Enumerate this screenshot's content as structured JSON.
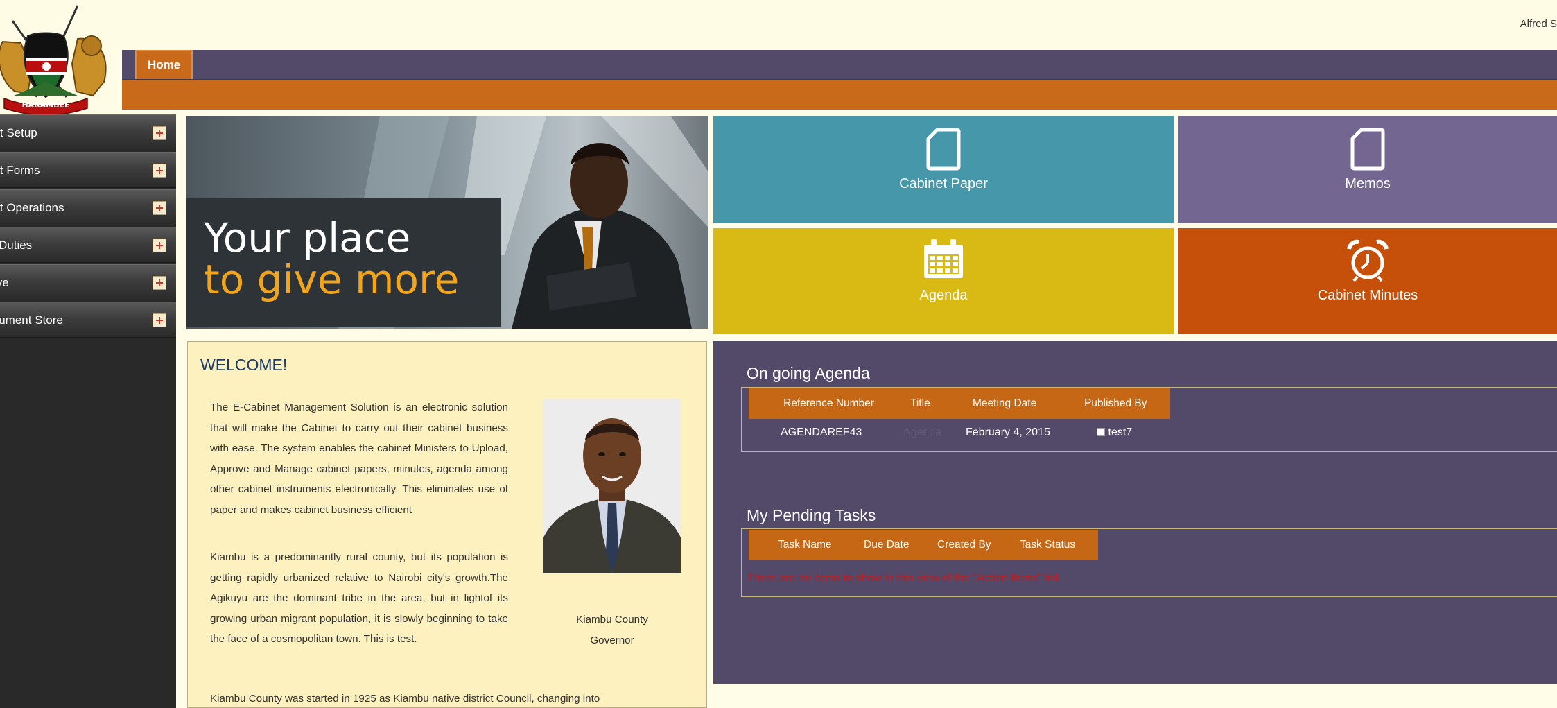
{
  "header": {
    "user_name": "Alfred S",
    "nav_tabs": [
      {
        "label": "Home"
      }
    ]
  },
  "sidebar": {
    "items": [
      {
        "label": "Cabinet Setup"
      },
      {
        "label": "Cabinet Forms"
      },
      {
        "label": "Cabinet Operations"
      },
      {
        "label": "Duties"
      },
      {
        "label": "Archive"
      },
      {
        "label": "Document Store"
      }
    ]
  },
  "banner": {
    "line1": "Your place",
    "line2": "to give more"
  },
  "tiles": {
    "cabinet_paper": {
      "label": "Cabinet Paper",
      "icon": "document-icon",
      "color": "#4597a9"
    },
    "memos": {
      "label": "Memos",
      "icon": "document-icon",
      "color": "#736792"
    },
    "agenda": {
      "label": "Agenda",
      "icon": "calendar-icon",
      "color": "#d9ba14"
    },
    "cabinet_minutes": {
      "label": "Cabinet Minutes",
      "icon": "alarm-clock-icon",
      "color": "#c6500a"
    }
  },
  "welcome": {
    "title": "WELCOME!",
    "para1": "The E-Cabinet Management Solution is an electronic solution that will make the Cabinet to carry out their cabinet business with ease. The system enables the cabinet Ministers to Upload, Approve and Manage cabinet papers, minutes, agenda among other  cabinet instruments electronically. This eliminates use of paper and makes cabinet business efficient",
    "para2": "Kiambu is a predominantly rural county, but its population is getting rapidly urbanized relative to Nairobi city's growth.The Agikuyu are the dominant tribe in the area, but in lightof its growing urban migrant population, it is slowly beginning to take the face of a cosmopolitan town. This is test.",
    "para3": "Kiambu County was started in 1925 as Kiambu native district Council, changing into",
    "photo_caption_line1": "Kiambu County",
    "photo_caption_line2": "Governor"
  },
  "ongoing_agenda": {
    "title": "On going Agenda",
    "columns": [
      "Reference Number",
      "Title",
      "Meeting Date",
      "Published By"
    ],
    "rows": [
      {
        "reference_number": "AGENDAREF43",
        "title": "Agenda",
        "meeting_date": "February 4, 2015",
        "published_by": "test7"
      }
    ]
  },
  "pending_tasks": {
    "title": "My Pending Tasks",
    "columns": [
      "Task Name",
      "Due Date",
      "Created By",
      "Task Status"
    ],
    "empty_message": "There are no items to show in this view of the \"Action Items\" list."
  },
  "colors": {
    "nav_bg": "#524a68",
    "accent_orange": "#c86a1a",
    "welcome_bg": "#fdf1bf",
    "error_text": "#d11515"
  }
}
